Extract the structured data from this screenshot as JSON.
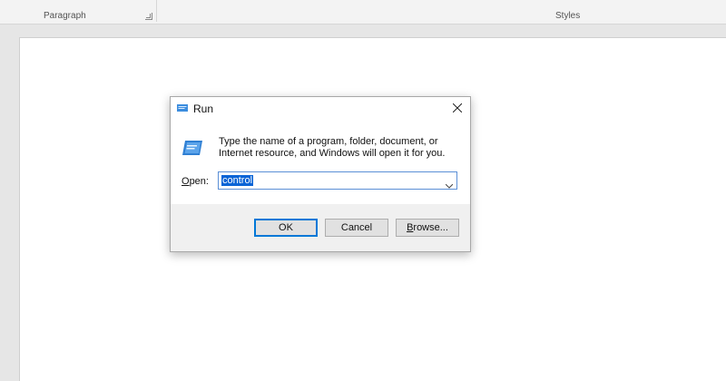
{
  "ribbon": {
    "paragraph_label": "Paragraph",
    "styles_label": "Styles"
  },
  "dialog": {
    "title": "Run",
    "description": "Type the name of a program, folder, document, or Internet resource, and Windows will open it for you.",
    "open_label": {
      "mnemonic": "O",
      "rest": "pen:"
    },
    "open_value": "control",
    "buttons": {
      "ok": "OK",
      "cancel": "Cancel",
      "browse": {
        "mnemonic": "B",
        "rest": "rowse..."
      }
    }
  },
  "colors": {
    "accent": "#0078d7",
    "selection": "#0a64d6",
    "button_bar": "#f0f0f0"
  },
  "icons": {
    "title": "run-icon",
    "close": "close-icon",
    "large": "run-icon",
    "dropdown": "chevron-down-icon",
    "launcher": "dialog-launcher-icon"
  }
}
